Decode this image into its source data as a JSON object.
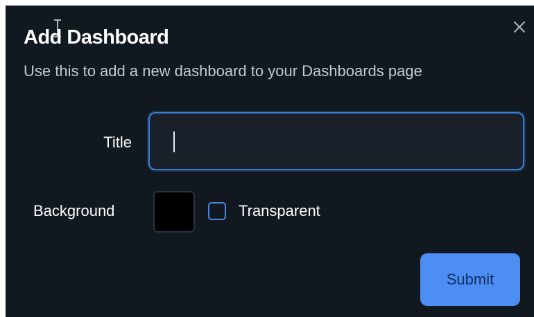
{
  "dialog": {
    "title": "Add Dashboard",
    "subtitle": "Use this to add a new dashboard to your Dashboards page",
    "close_icon": "close-icon"
  },
  "form": {
    "title_label": "Title",
    "title_value": "",
    "background_label": "Background",
    "background_color": "#000000",
    "transparent_label": "Transparent",
    "transparent_checked": false,
    "submit_label": "Submit"
  },
  "colors": {
    "dialog_bg": "#111820",
    "accent": "#4d8ef3",
    "input_border": "#3a7fd8"
  }
}
